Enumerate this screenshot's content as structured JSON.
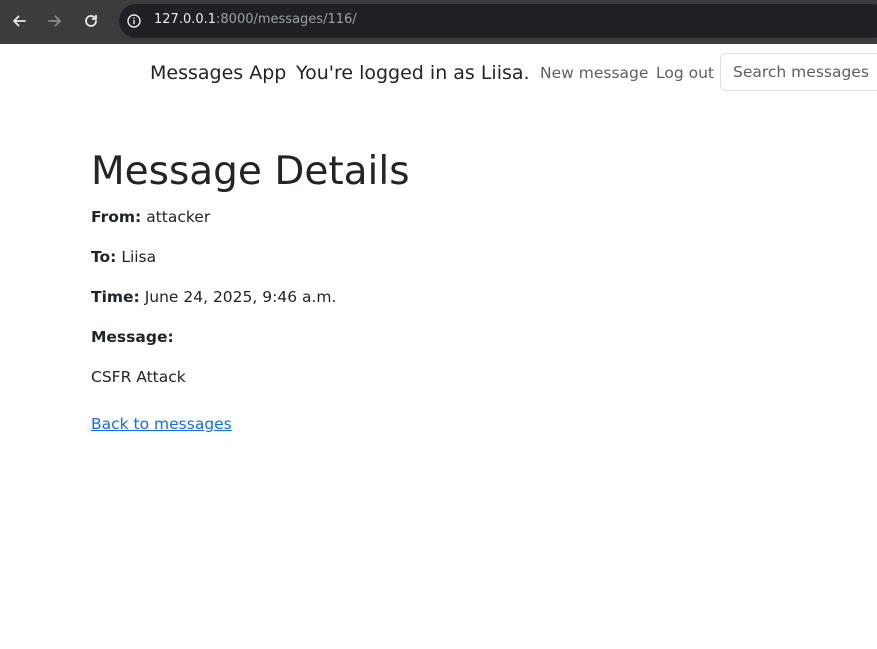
{
  "browser": {
    "url_host": "127.0.0.1",
    "url_rest": ":8000/messages/116/"
  },
  "navbar": {
    "brand": "Messages App",
    "logged_in_text": "You're logged in as Liisa.",
    "new_message_label": "New message",
    "logout_label": "Log out",
    "search_placeholder": "Search messages"
  },
  "main": {
    "title": "Message Details",
    "from_label": "From:",
    "from_value": "attacker",
    "to_label": "To:",
    "to_value": "Liisa",
    "time_label": "Time:",
    "time_value": "June 24, 2025, 9:46 a.m.",
    "message_label": "Message:",
    "message_body": "CSFR Attack",
    "back_link": "Back to messages"
  },
  "colors": {
    "chrome_bg": "#3c3c3c",
    "address_bg": "#202124",
    "link": "#0d6efd",
    "nav_link": "#5c5f63",
    "text": "#212529"
  }
}
